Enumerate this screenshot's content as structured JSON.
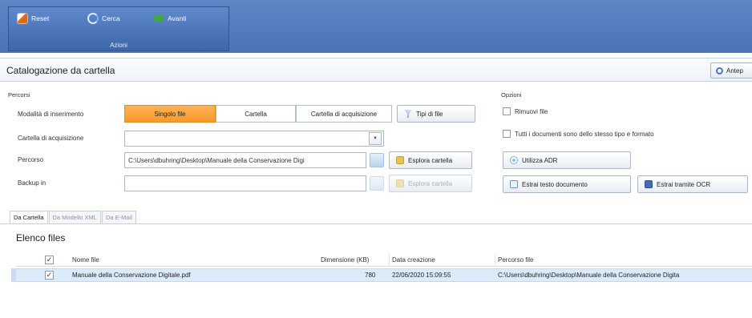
{
  "ribbon": {
    "buttons": [
      {
        "label": "Reset",
        "icon": "reset-icon"
      },
      {
        "label": "Cerca",
        "icon": "refresh-icon"
      },
      {
        "label": "Avanti",
        "icon": "forward-arrow-icon"
      }
    ],
    "group_label": "Azioni"
  },
  "header": {
    "title": "Catalogazione da cartella",
    "preview_button": "Antep"
  },
  "percorsi": {
    "section_label": "Percorsi",
    "mode_label": "Modalità di inserimento",
    "modes": [
      "Singolo file",
      "Cartella",
      "Cartella di acquisizione"
    ],
    "active_mode": "Singolo file",
    "file_types_button": "Tipi di file",
    "acquisition_folder_label": "Cartella di acquisizione",
    "acquisition_folder_value": "",
    "path_label": "Percorso",
    "path_value": "C:\\Users\\dbuhring\\Desktop\\Manuale della Conservazione Digi",
    "explore_button": "Esplora cartella",
    "backup_label": "Backup in",
    "backup_value": "",
    "explore_backup_button": "Esplora cartella"
  },
  "opzioni": {
    "section_label": "Opzioni",
    "remove_files": "Rimuovi file",
    "same_type": "Tutti i documenti sono dello stesso tipo e formato",
    "use_adr_button": "Utilizza ADR",
    "extract_text_button": "Estrai testo documento",
    "extract_ocr_button": "Estrai tramite OCR"
  },
  "tabs": [
    "Da Cartella",
    "Da Modello XML",
    "Da E-Mail"
  ],
  "files": {
    "title": "Elenco files",
    "columns": [
      "Nome file",
      "Dimensione (KB)",
      "Data creazione",
      "Percorso file"
    ],
    "rows": [
      {
        "name": "Manuale della Conservazione Digitale.pdf",
        "size": "780",
        "created": "22/06/2020 15:09:55",
        "path": "C:\\Users\\dbuhring\\Desktop\\Manuale della Conservazione Digita"
      }
    ]
  },
  "colors": {
    "ribbon": "#4a74b8",
    "active_segment": "#f49a2c",
    "selected_row": "#dcebfa"
  }
}
